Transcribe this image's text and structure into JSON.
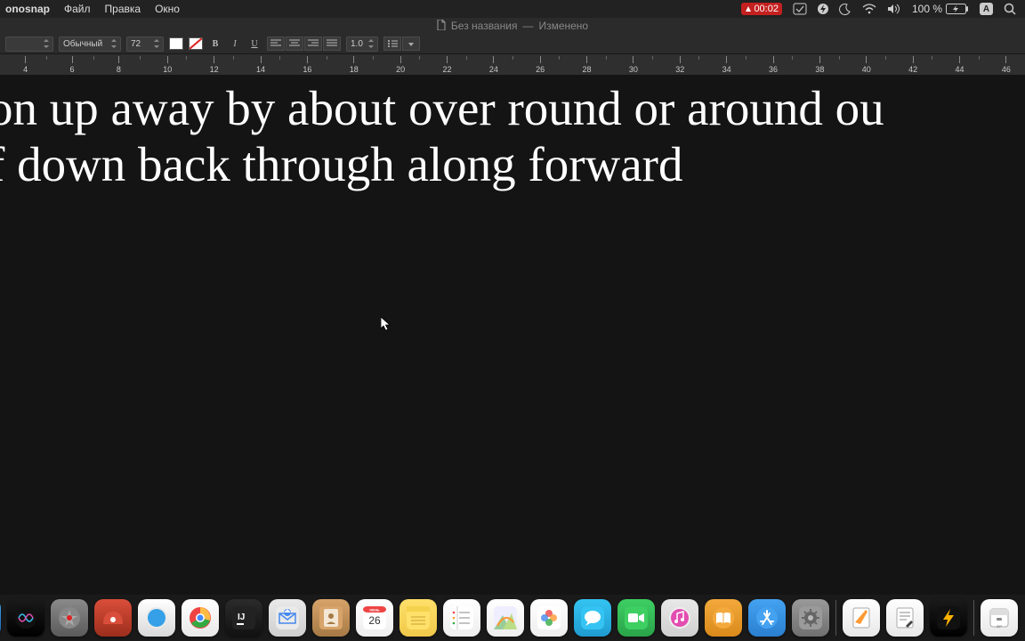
{
  "menubar": {
    "app_name": "onosnap",
    "items": [
      "Файл",
      "Правка",
      "Окно"
    ],
    "status": {
      "time": "00:02",
      "battery": "100 %",
      "language": "A"
    }
  },
  "titlebar": {
    "doc_name": "Без названия",
    "status": "Изменено"
  },
  "toolbar": {
    "style": "Обычный",
    "font_size": "72",
    "bold_label": "B",
    "italic_label": "I",
    "underline_label": "U",
    "spacing": "1.0"
  },
  "ruler": {
    "ticks": [
      4,
      6,
      8,
      10,
      12,
      14,
      16,
      18,
      20,
      22,
      24,
      26,
      28,
      30,
      32,
      34,
      36,
      38,
      40,
      42,
      44,
      46
    ]
  },
  "document": {
    "line1": " on up away by about over round or around ou",
    "line2": "f down back through along forward"
  },
  "dock": {
    "apps": [
      {
        "name": "finder",
        "c1": "#3fa9f5",
        "c2": "#1b5fa8"
      },
      {
        "name": "siri",
        "c1": "#1a1a1a",
        "c2": "#000"
      },
      {
        "name": "launchpad",
        "c1": "#8a8a8a",
        "c2": "#5a5a5a"
      },
      {
        "name": "monosnap",
        "c1": "#d94e3a",
        "c2": "#9c2e1c"
      },
      {
        "name": "safari",
        "c1": "#ffffff",
        "c2": "#d9d9d9"
      },
      {
        "name": "chrome",
        "c1": "#ffffff",
        "c2": "#e9e9e9"
      },
      {
        "name": "intellij",
        "c1": "#2b2b2b",
        "c2": "#111"
      },
      {
        "name": "mail",
        "c1": "#e9e9e9",
        "c2": "#cfcfcf"
      },
      {
        "name": "contacts",
        "c1": "#d7a36a",
        "c2": "#a67a45"
      },
      {
        "name": "calendar",
        "c1": "#ffffff",
        "c2": "#eee"
      },
      {
        "name": "notes",
        "c1": "#ffe06a",
        "c2": "#f0c94a"
      },
      {
        "name": "reminders",
        "c1": "#ffffff",
        "c2": "#eee"
      },
      {
        "name": "maps",
        "c1": "#ffffff",
        "c2": "#eee"
      },
      {
        "name": "photos",
        "c1": "#ffffff",
        "c2": "#eee"
      },
      {
        "name": "messages",
        "c1": "#34c3f2",
        "c2": "#1f9cd0"
      },
      {
        "name": "facetime",
        "c1": "#3ecf63",
        "c2": "#2aa349"
      },
      {
        "name": "itunes",
        "c1": "#e8e8e8",
        "c2": "#d0d0d0"
      },
      {
        "name": "ibooks",
        "c1": "#f3a93c",
        "c2": "#d98a1a"
      },
      {
        "name": "appstore",
        "c1": "#44a2f1",
        "c2": "#2a7fd0"
      },
      {
        "name": "settings",
        "c1": "#9a9a9a",
        "c2": "#707070"
      }
    ],
    "right": [
      {
        "name": "pages",
        "c1": "#ffffff",
        "c2": "#e8e8e8"
      },
      {
        "name": "textedit",
        "c1": "#ffffff",
        "c2": "#e8e8e8"
      },
      {
        "name": "bolt-app",
        "c1": "#1a1a1a",
        "c2": "#000"
      }
    ],
    "right2": [
      {
        "name": "archive",
        "c1": "#ffffff",
        "c2": "#e8e8e8"
      }
    ],
    "trash_name": "trash"
  },
  "calendar_badge": {
    "month": "ИЮНЬ",
    "day": "26"
  }
}
